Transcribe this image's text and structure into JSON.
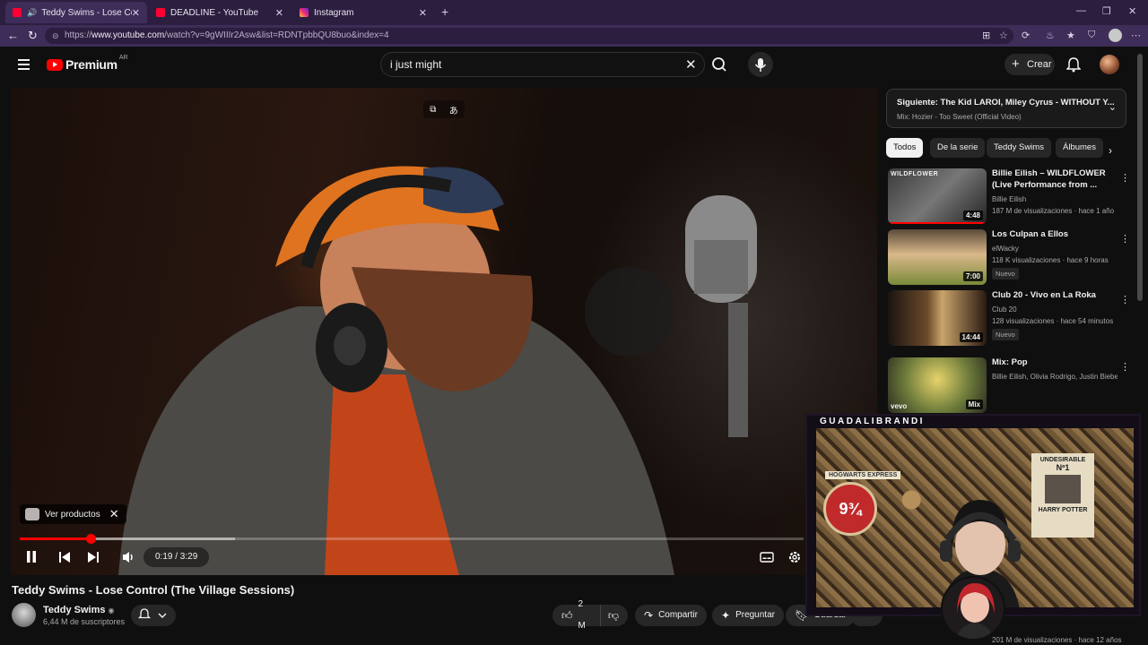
{
  "browser": {
    "tabs": [
      {
        "title": "Teddy Swims - Lose Control (T",
        "active": true,
        "icon": "youtube-favicon",
        "audio": true
      },
      {
        "title": "DEADLINE - YouTube",
        "active": false,
        "icon": "youtube-favicon"
      },
      {
        "title": "Instagram",
        "active": false,
        "icon": "instagram-favicon"
      }
    ],
    "url_prefix": "https://",
    "url_host": "www.youtube.com",
    "url_path": "/watch?v=9gWIIIr2Asw&list=RDNTpbbQU8buo&index=4",
    "accent_color": "#3e2d58"
  },
  "header": {
    "logo_text": "Premium",
    "country_code": "AR",
    "search_value": "i just might",
    "create_label": "Crear"
  },
  "player": {
    "products_chip": "Ver productos",
    "time_label": "0:19 / 3:29",
    "progress_fraction": 0.0909,
    "state": "playing"
  },
  "video": {
    "title": "Teddy Swims - Lose Control (The Village Sessions)",
    "channel": "Teddy Swims",
    "subscribers": "6,44 M de suscriptores",
    "likes": "2 M",
    "share_label": "Compartir",
    "ask_label": "Preguntar",
    "save_label": "Guardar"
  },
  "sidebar": {
    "up_next_title": "Siguiente: The Kid LAROI, Miley Cyrus - WITHOUT Y...",
    "up_next_sub": "Mix: Hozier - Too Sweet (Official Video)",
    "filters": [
      "Todos",
      "De la serie",
      "Teddy Swims",
      "Álbumes"
    ],
    "recommendations": [
      {
        "title": "Billie Eilish – WILDFLOWER (Live Performance from ...",
        "channel": "Billie Eilish",
        "meta": "187 M de visualizaciones · hace 1 año",
        "duration": "4:48",
        "thumb_text": "WILDFLOWER"
      },
      {
        "title": "Los Culpan a Ellos",
        "channel": "elWacky",
        "meta": "118 K visualizaciones · hace 9 horas",
        "duration": "7:00",
        "badge": "Nuevo"
      },
      {
        "title": "Club 20 - Vivo en La Roka",
        "channel": "Club 20",
        "meta": "128 visualizaciones · hace 54 minutos",
        "duration": "14:44",
        "badge": "Nuevo"
      },
      {
        "title": "Mix: Pop",
        "channel": "Billie Eilish, Olivia Rodrigo, Justin Bieber ...",
        "meta": "",
        "duration": "Mix",
        "thumb_text": "vevo"
      }
    ],
    "partial_meta": "201 M de visualizaciones · hace 12 años"
  },
  "webcam": {
    "banner": "GUADALIBRANDI",
    "platform_text": "9¾",
    "wanted_lines": [
      "UNDESIRABLE",
      "Nº1",
      "HARRY POTTER"
    ],
    "hogwarts_text": "HOGWARTS EXPRESS"
  }
}
